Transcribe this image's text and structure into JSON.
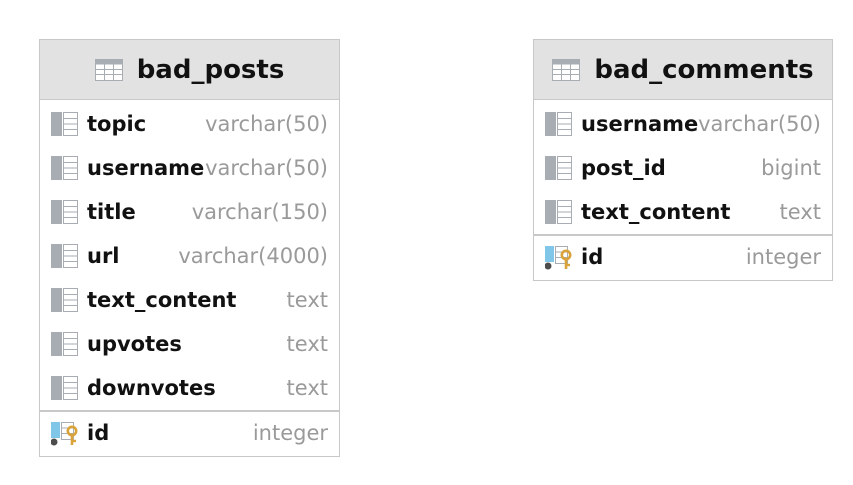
{
  "tables": [
    {
      "name": "bad_posts",
      "columns": [
        {
          "name": "topic",
          "type": "varchar(50)"
        },
        {
          "name": "username",
          "type": "varchar(50)"
        },
        {
          "name": "title",
          "type": "varchar(150)"
        },
        {
          "name": "url",
          "type": "varchar(4000)"
        },
        {
          "name": "text_content",
          "type": "text"
        },
        {
          "name": "upvotes",
          "type": "text"
        },
        {
          "name": "downvotes",
          "type": "text"
        }
      ],
      "primary_key": {
        "name": "id",
        "type": "integer"
      }
    },
    {
      "name": "bad_comments",
      "columns": [
        {
          "name": "username",
          "type": "varchar(50)"
        },
        {
          "name": "post_id",
          "type": "bigint"
        },
        {
          "name": "text_content",
          "type": "text"
        }
      ],
      "primary_key": {
        "name": "id",
        "type": "integer"
      }
    }
  ],
  "icons": {
    "table": "table-icon",
    "column": "column-icon",
    "primary_key": "primary-key-icon"
  },
  "colors": {
    "header_bg": "#e2e2e2",
    "border": "#c8c8c8",
    "icon_gray": "#a7adb3",
    "key_blue": "#7fc6e8",
    "key_gold": "#d9a33a",
    "type_text": "#9a9a9a"
  }
}
